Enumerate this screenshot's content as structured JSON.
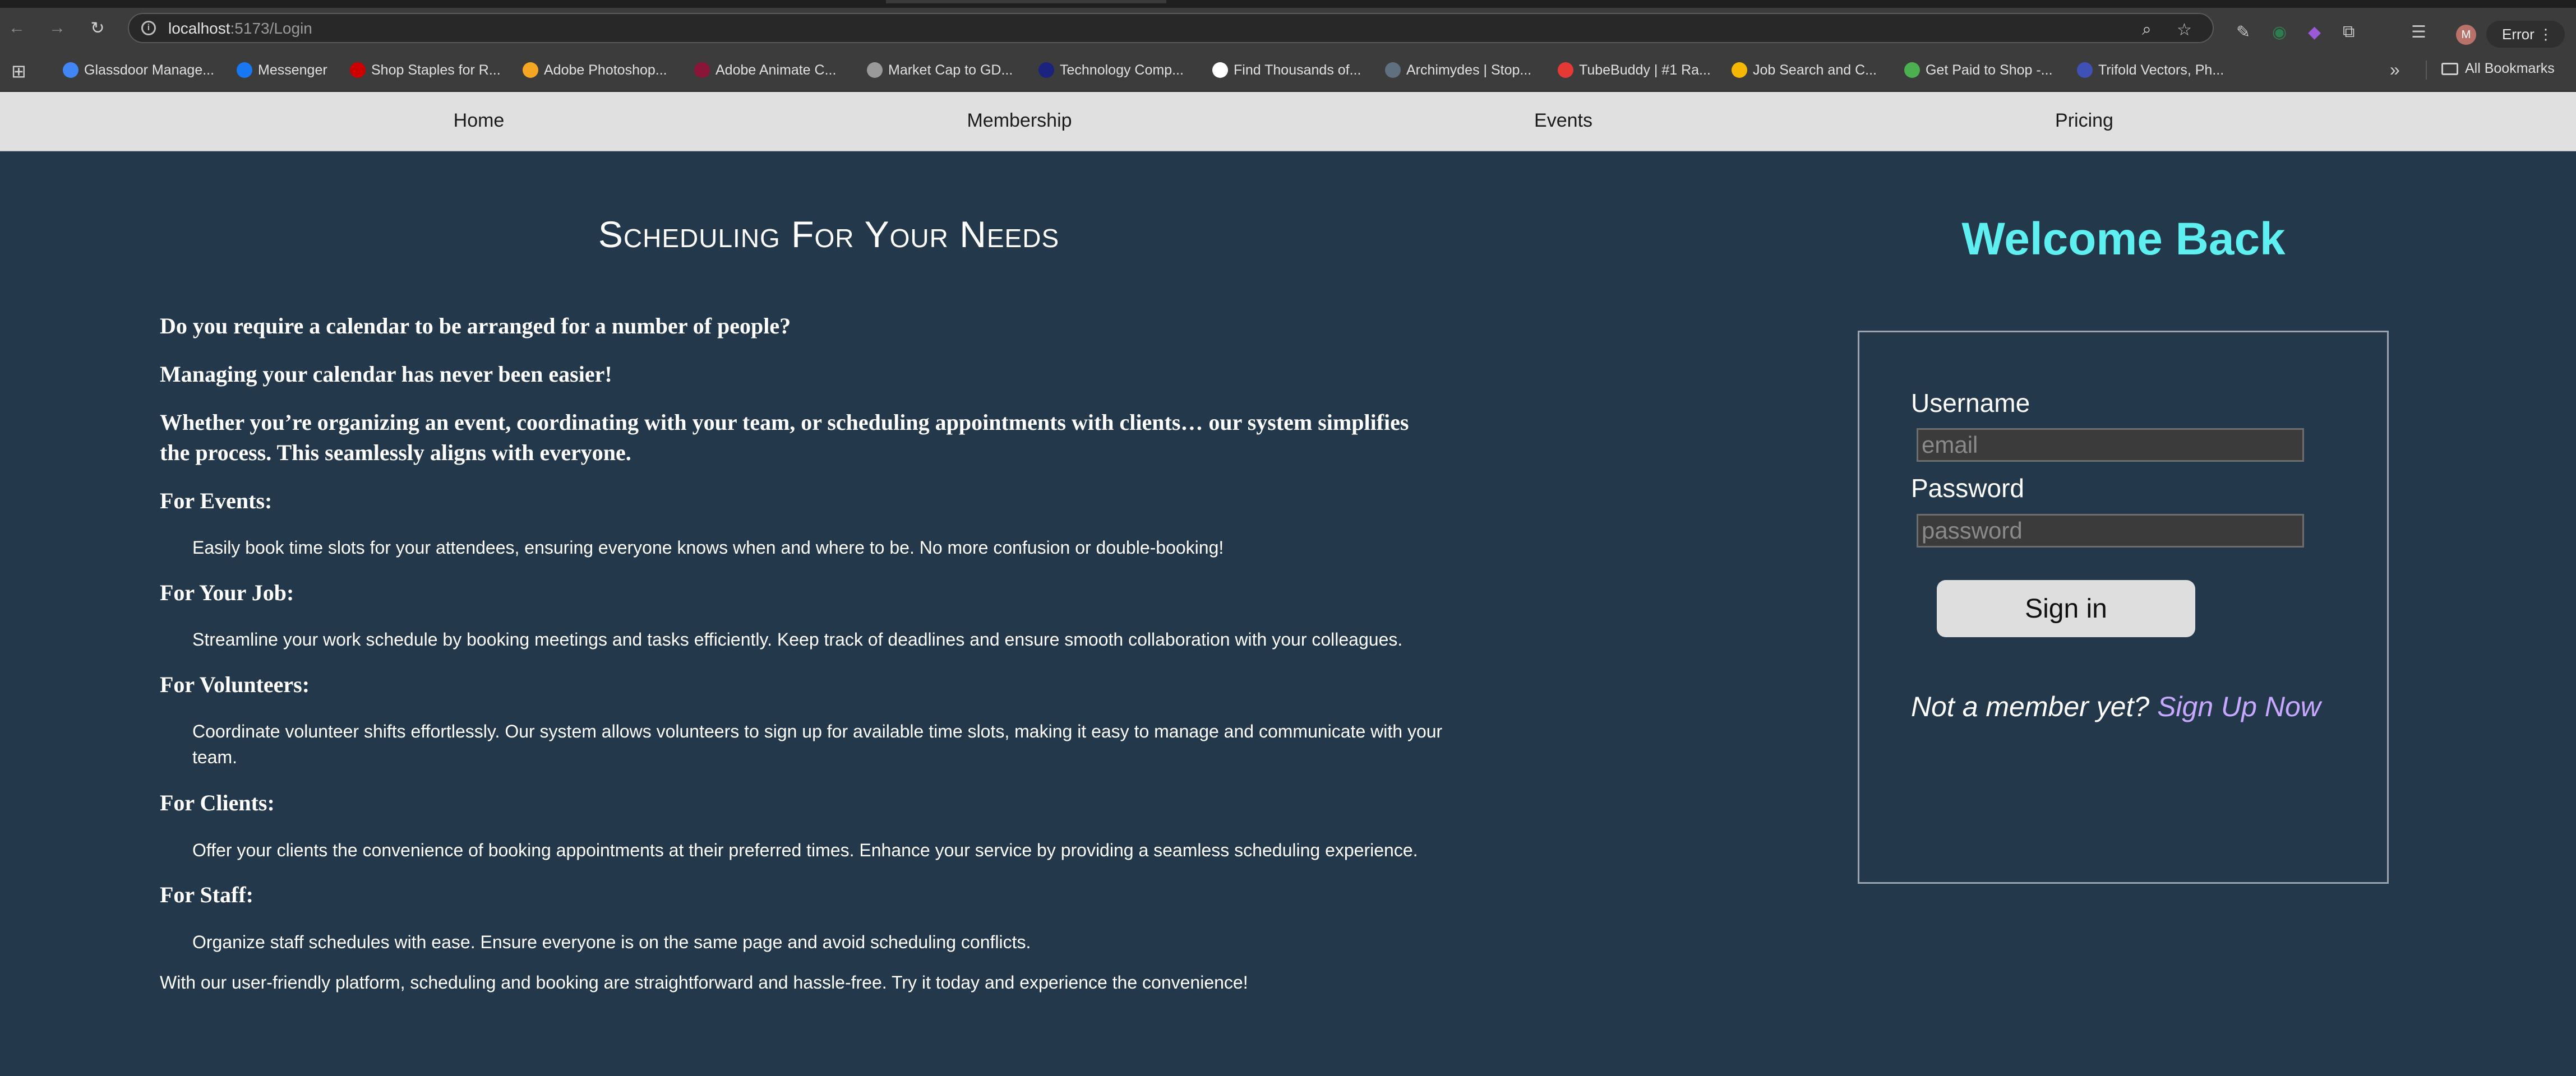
{
  "browser": {
    "url_host": "localhost",
    "url_path": ":5173/Login",
    "profile_initial": "M",
    "error_label": "Error",
    "bookmarks": [
      {
        "label": "Glassdoor Manage...",
        "color": "#4285f4"
      },
      {
        "label": "Messenger",
        "color": "#1877f2"
      },
      {
        "label": "Shop Staples for R...",
        "color": "#cc0000"
      },
      {
        "label": "Adobe Photoshop...",
        "color": "#f5a623"
      },
      {
        "label": "Adobe Animate C...",
        "color": "#8a1538"
      },
      {
        "label": "Market Cap to GD...",
        "color": "#9a9a9a"
      },
      {
        "label": "Technology Comp...",
        "color": "#1a237e"
      },
      {
        "label": "Find Thousands of...",
        "color": "#ffffff"
      },
      {
        "label": "Archimydes | Stop...",
        "color": "#607080"
      },
      {
        "label": "TubeBuddy | #1 Ra...",
        "color": "#e53935"
      },
      {
        "label": "Job Search and C...",
        "color": "#f5b800"
      },
      {
        "label": "Get Paid to Shop -...",
        "color": "#4caf50"
      },
      {
        "label": "Trifold Vectors, Ph...",
        "color": "#3f51b5"
      }
    ],
    "all_bookmarks_label": "All Bookmarks"
  },
  "nav": {
    "items": [
      "Home",
      "Membership",
      "Events",
      "Pricing"
    ]
  },
  "main": {
    "title": "Scheduling For Your Needs",
    "intro": [
      "Do you require a calendar to be arranged for a number of people?",
      "Managing your calendar has never been easier!",
      "Whether you’re organizing an event, coordinating with your team, or scheduling appointments with clients… our system simplifies the process. This seamlessly aligns with everyone."
    ],
    "sections": [
      {
        "heading": "For Events:",
        "text": "Easily book time slots for your attendees, ensuring everyone knows when and where to be. No more confusion or double-booking!"
      },
      {
        "heading": "For Your Job:",
        "text": "Streamline your work schedule by booking meetings and tasks efficiently. Keep track of deadlines and ensure smooth collaboration with your colleagues."
      },
      {
        "heading": "For Volunteers:",
        "text": "Coordinate volunteer shifts effortlessly. Our system allows volunteers to sign up for available time slots, making it easy to manage and communicate with your team."
      },
      {
        "heading": "For Clients:",
        "text": "Offer your clients the convenience of booking appointments at their preferred times. Enhance your service by providing a seamless scheduling experience."
      },
      {
        "heading": "For Staff:",
        "text": "Organize staff schedules with ease. Ensure everyone is on the same page and avoid scheduling conflicts."
      }
    ],
    "closing": "With our user-friendly platform, scheduling and booking are straightforward and hassle-free. Try it today and experience the convenience!"
  },
  "login": {
    "welcome": "Welcome Back",
    "username_label": "Username",
    "username_placeholder": "email",
    "password_label": "Password",
    "password_placeholder": "password",
    "signin_label": "Sign in",
    "not_member": "Not a member yet?",
    "signup_link": "Sign Up Now"
  },
  "colors": {
    "page_bg": "#23384a",
    "nav_bg": "#e0e0e0",
    "welcome": "#5ef0f0",
    "signup_link": "#c8a8ff"
  }
}
